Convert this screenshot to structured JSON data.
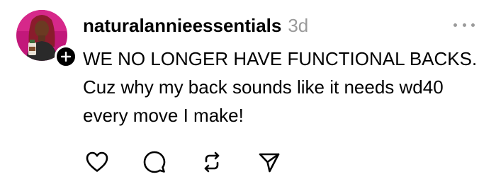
{
  "post": {
    "username": "naturalannieessentials",
    "timestamp": "3d",
    "text": "WE NO LONGER HAVE FUNCTIONAL BACKS. Cuz why my back sounds like it needs wd40 every move I make!"
  },
  "icons": {
    "more": "more-options-icon",
    "follow": "plus-icon",
    "like": "heart-icon",
    "comment": "comment-icon",
    "repost": "repost-icon",
    "share": "send-icon"
  },
  "colors": {
    "text": "#000000",
    "muted": "#9a9a9a",
    "avatar_bg": "#c2187a"
  }
}
